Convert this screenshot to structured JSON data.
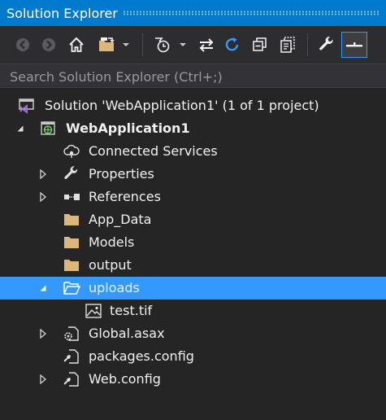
{
  "window": {
    "title": "Solution Explorer"
  },
  "search": {
    "placeholder": "Search Solution Explorer (Ctrl+;)"
  },
  "tree": {
    "solution": "Solution 'WebApplication1' (1 of 1 project)",
    "project": "WebApplication1",
    "connected_services": "Connected Services",
    "properties": "Properties",
    "references": "References",
    "app_data": "App_Data",
    "models": "Models",
    "output": "output",
    "uploads": "uploads",
    "test_tif": "test.tif",
    "global_asax": "Global.asax",
    "packages_config": "packages.config",
    "web_config": "Web.config"
  },
  "colors": {
    "accent": "#007acc",
    "selection": "#3399ff",
    "background": "#252526",
    "toolbar": "#2d2d30",
    "folder": "#dcb67a",
    "vs_purple": "#68217a"
  },
  "icons": [
    "back-icon",
    "forward-icon",
    "home-icon",
    "sync-view-icon",
    "chevron-down-icon",
    "pending-changes-filter-icon",
    "chevron-down-icon",
    "sync-with-active-document-icon",
    "refresh-icon",
    "collapse-all-icon",
    "show-all-files-icon",
    "properties-wrench-icon",
    "preview-selected-items-icon"
  ]
}
